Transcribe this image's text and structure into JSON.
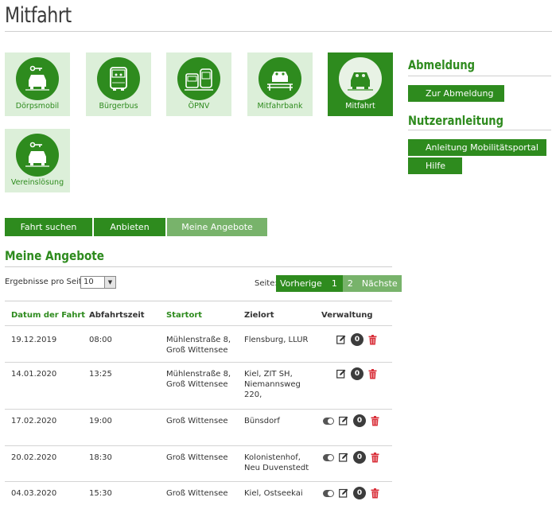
{
  "page": {
    "title": "Mitfahrt"
  },
  "tiles": [
    {
      "label": "Dörpsmobil",
      "icon": "car-key-icon"
    },
    {
      "label": "Bürgerbus",
      "icon": "bus-icon"
    },
    {
      "label": "ÖPNV",
      "icon": "bus-train-icon"
    },
    {
      "label": "Mitfahrbank",
      "icon": "car-bench-icon"
    },
    {
      "label": "Mitfahrt",
      "icon": "car-people-icon",
      "active": true
    },
    {
      "label": "Vereinslösung",
      "icon": "car-key-icon"
    }
  ],
  "sidebar": {
    "abmeldung_heading": "Abmeldung",
    "abmeldung_button": "Zur Abmeldung",
    "nutzer_heading": "Nutzeranleitung",
    "anleitung_button": "Anleitung Mobilitätsportal",
    "hilfe_button": "Hilfe"
  },
  "tabs": [
    {
      "label": "Fahrt suchen"
    },
    {
      "label": "Anbieten"
    },
    {
      "label": "Meine Angebote",
      "active": true
    }
  ],
  "section": {
    "title": "Meine Angebote"
  },
  "controls": {
    "per_page_label": "Ergebnisse pro Seite:",
    "per_page_value": "10",
    "page_label": "Seite:",
    "prev": "Vorherige",
    "page1": "1",
    "page2": "2",
    "next": "Nächste"
  },
  "table": {
    "headers": [
      "Datum der Fahrt",
      "Abfahrtszeit",
      "Startort",
      "Zielort",
      "Verwaltung"
    ],
    "rows": [
      {
        "date": "19.12.2019",
        "time": "08:00",
        "start": [
          "Mühlenstraße 8,",
          "Groß Wittensee"
        ],
        "ziel": [
          "Flensburg, LLUR"
        ],
        "count": "0",
        "toggle": false
      },
      {
        "date": "14.01.2020",
        "time": "13:25",
        "start": [
          "Mühlenstraße 8,",
          "Groß Wittensee"
        ],
        "ziel": [
          "Kiel, ZIT SH,",
          "Niemannsweg",
          "220,"
        ],
        "count": "0",
        "toggle": false
      },
      {
        "date": "17.02.2020",
        "time": "19:00",
        "start": [
          "Groß Wittensee"
        ],
        "ziel": [
          "Bünsdorf"
        ],
        "count": "0",
        "toggle": true
      },
      {
        "date": "20.02.2020",
        "time": "18:30",
        "start": [
          "Groß Wittensee"
        ],
        "ziel": [
          "Kolonistenhof,",
          "Neu Duvenstedt"
        ],
        "count": "0",
        "toggle": true
      },
      {
        "date": "04.03.2020",
        "time": "15:30",
        "start": [
          "Groß Wittensee"
        ],
        "ziel": [
          "Kiel, Ostseekai"
        ],
        "count": "0",
        "toggle": true
      }
    ]
  },
  "colors": {
    "accent": "#2e8b1e",
    "accent_light": "#78b36b",
    "tile_bg": "#dcefd9",
    "delete": "#d9303a"
  }
}
